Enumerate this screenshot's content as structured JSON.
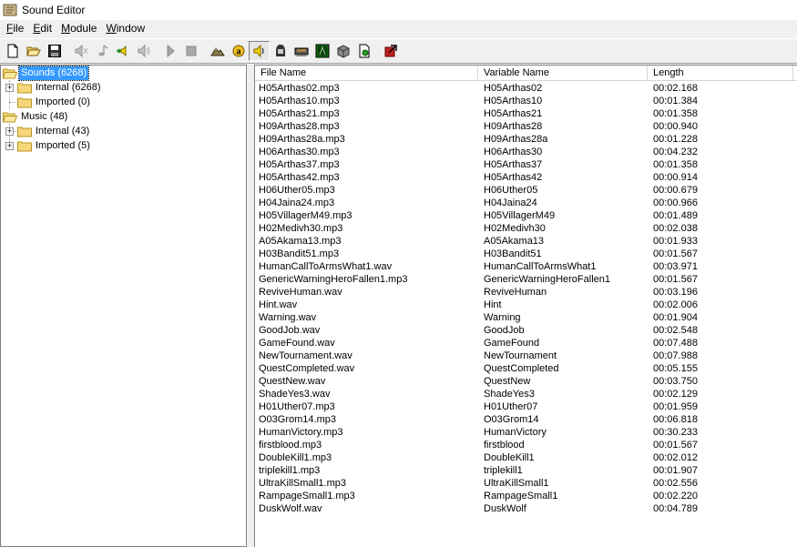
{
  "window": {
    "title": "Sound Editor"
  },
  "menu": [
    "File",
    "Edit",
    "Module",
    "Window"
  ],
  "tree": {
    "sounds": {
      "label": "Sounds (6268)",
      "internal": "Internal (6268)",
      "imported": "Imported (0)"
    },
    "music": {
      "label": "Music (48)",
      "internal": "Internal (43)",
      "imported": "Imported (5)"
    }
  },
  "list": {
    "columns": [
      "File Name",
      "Variable Name",
      "Length"
    ],
    "rows": [
      [
        "H05Arthas02.mp3",
        "H05Arthas02",
        "00:02.168"
      ],
      [
        "H05Arthas10.mp3",
        "H05Arthas10",
        "00:01.384"
      ],
      [
        "H05Arthas21.mp3",
        "H05Arthas21",
        "00:01.358"
      ],
      [
        "H09Arthas28.mp3",
        "H09Arthas28",
        "00:00.940"
      ],
      [
        "H09Arthas28a.mp3",
        "H09Arthas28a",
        "00:01.228"
      ],
      [
        "H06Arthas30.mp3",
        "H06Arthas30",
        "00:04.232"
      ],
      [
        "H05Arthas37.mp3",
        "H05Arthas37",
        "00:01.358"
      ],
      [
        "H05Arthas42.mp3",
        "H05Arthas42",
        "00:00.914"
      ],
      [
        "H06Uther05.mp3",
        "H06Uther05",
        "00:00.679"
      ],
      [
        "H04Jaina24.mp3",
        "H04Jaina24",
        "00:00.966"
      ],
      [
        "H05VillagerM49.mp3",
        "H05VillagerM49",
        "00:01.489"
      ],
      [
        "H02Medivh30.mp3",
        "H02Medivh30",
        "00:02.038"
      ],
      [
        "A05Akama13.mp3",
        "A05Akama13",
        "00:01.933"
      ],
      [
        "H03Bandit51.mp3",
        "H03Bandit51",
        "00:01.567"
      ],
      [
        "HumanCallToArmsWhat1.wav",
        "HumanCallToArmsWhat1",
        "00:03.971"
      ],
      [
        "GenericWarningHeroFallen1.mp3",
        "GenericWarningHeroFallen1",
        "00:01.567"
      ],
      [
        "ReviveHuman.wav",
        "ReviveHuman",
        "00:03.196"
      ],
      [
        "Hint.wav",
        "Hint",
        "00:02.006"
      ],
      [
        "Warning.wav",
        "Warning",
        "00:01.904"
      ],
      [
        "GoodJob.wav",
        "GoodJob",
        "00:02.548"
      ],
      [
        "GameFound.wav",
        "GameFound",
        "00:07.488"
      ],
      [
        "NewTournament.wav",
        "NewTournament",
        "00:07.988"
      ],
      [
        "QuestCompleted.wav",
        "QuestCompleted",
        "00:05.155"
      ],
      [
        "QuestNew.wav",
        "QuestNew",
        "00:03.750"
      ],
      [
        "ShadeYes3.wav",
        "ShadeYes3",
        "00:02.129"
      ],
      [
        "H01Uther07.mp3",
        "H01Uther07",
        "00:01.959"
      ],
      [
        "O03Grom14.mp3",
        "O03Grom14",
        "00:06.818"
      ],
      [
        "HumanVictory.mp3",
        "HumanVictory",
        "00:30.233"
      ],
      [
        "firstblood.mp3",
        "firstblood",
        "00:01.567"
      ],
      [
        "DoubleKill1.mp3",
        "DoubleKill1",
        "00:02.012"
      ],
      [
        "triplekill1.mp3",
        "triplekill1",
        "00:01.907"
      ],
      [
        "UltraKillSmall1.mp3",
        "UltraKillSmall1",
        "00:02.556"
      ],
      [
        "RampageSmall1.mp3",
        "RampageSmall1",
        "00:02.220"
      ],
      [
        "DuskWolf.wav",
        "DuskWolf",
        "00:04.789"
      ]
    ]
  },
  "toolbar": [
    "new-file-icon",
    "open-folder-icon",
    "save-disk-icon",
    "mute-speaker-icon",
    "music-note-icon",
    "import-sound-icon",
    "speaker-icon",
    "play-icon",
    "stop-icon",
    "terrain-editor-icon",
    "unit-editor-icon",
    "sound-editor-icon",
    "ai-editor-icon",
    "object-editor-icon",
    "campaign-editor-icon",
    "import-manager-icon",
    "object-manager-icon",
    "test-map-icon"
  ],
  "colors": {
    "selection": "#3399ff",
    "folder": "#f5d67a"
  }
}
